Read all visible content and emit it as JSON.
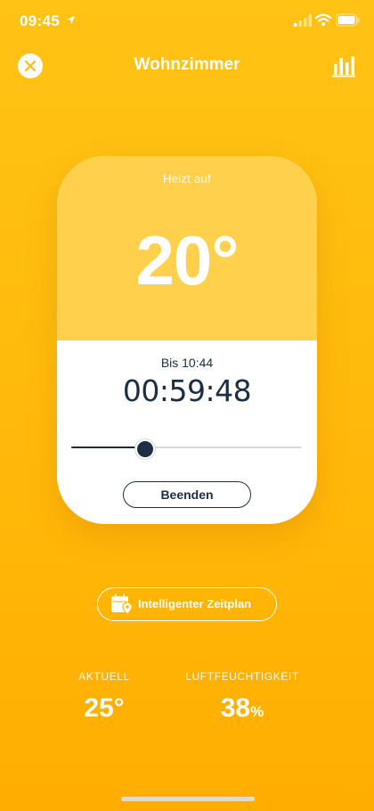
{
  "status_bar": {
    "time": "09:45",
    "location_icon": "location-arrow-icon",
    "signal_icon": "cellular-signal-icon",
    "wifi_icon": "wifi-icon",
    "battery_icon": "battery-icon"
  },
  "header": {
    "title": "Wohnzimmer",
    "close_icon": "close-icon",
    "chart_icon": "bar-chart-icon"
  },
  "card": {
    "status": "Heizt auf",
    "target_temperature": "20°",
    "until": "Bis 10:44",
    "timer": "00:59:48",
    "slider_fraction": 0.32,
    "end_button": "Beenden"
  },
  "schedule": {
    "label": "Intelligenter Zeitplan",
    "icon": "calendar-location-icon"
  },
  "stats": {
    "current_label": "AKTUELL",
    "current_value": "25°",
    "humidity_label": "LUFTFEUCHTIGKEIT",
    "humidity_value": "38",
    "humidity_unit": "%"
  },
  "colors": {
    "background": "#ffbb0e",
    "card_top": "#ffd04c",
    "accent_dark": "#1c2e44"
  }
}
